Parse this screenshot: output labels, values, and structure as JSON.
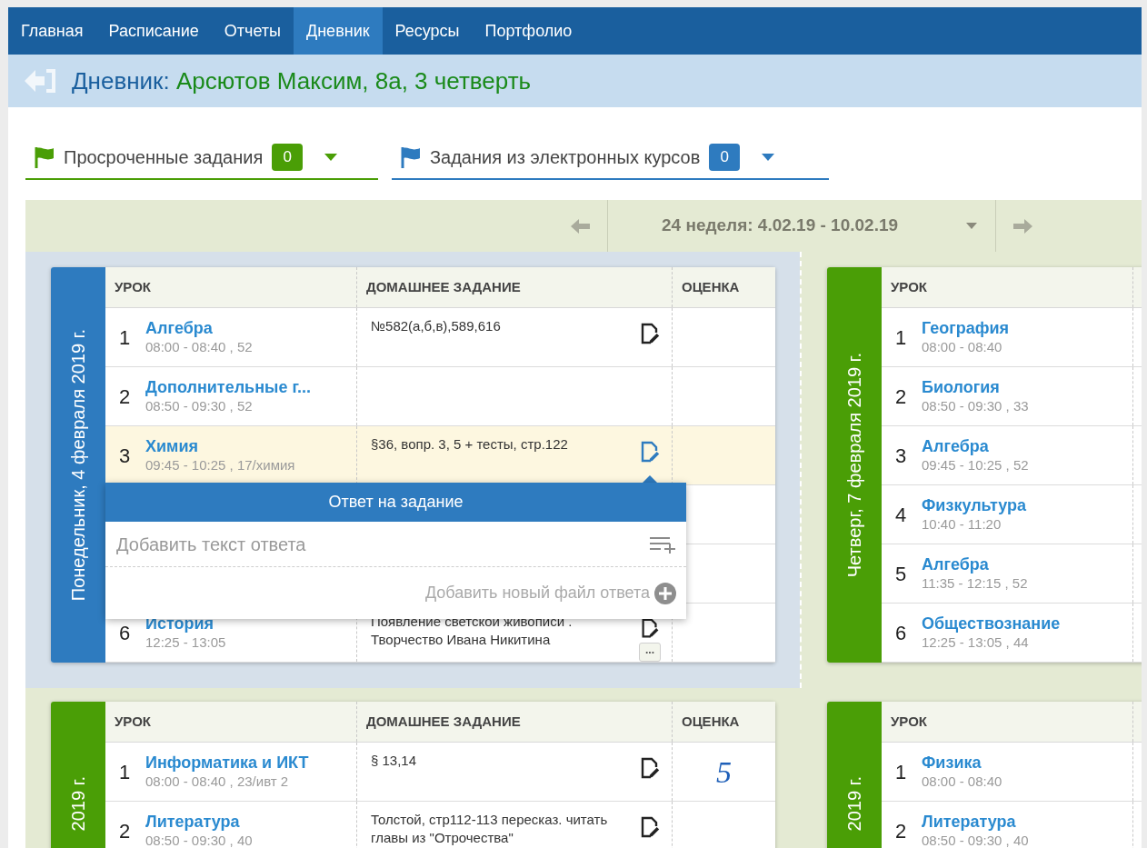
{
  "nav": [
    {
      "label": "Главная",
      "selected": false
    },
    {
      "label": "Расписание",
      "selected": false
    },
    {
      "label": "Отчеты",
      "selected": false
    },
    {
      "label": "Дневник",
      "selected": true
    },
    {
      "label": "Ресурсы",
      "selected": false
    },
    {
      "label": "Портфолио",
      "selected": false
    }
  ],
  "header": {
    "title": "Дневник:",
    "student": "Арсютов Максим, 8а, 3 четверть"
  },
  "filters": [
    {
      "label": "Просроченные задания",
      "count": "0",
      "color": "#4a9e06"
    },
    {
      "label": "Задания из электронных курсов",
      "count": "0",
      "color": "#2e7bbf"
    }
  ],
  "week": {
    "label": "24 неделя: 4.02.19 - 10.02.19"
  },
  "days": [
    {
      "date": "Понедельник, 4 февраля 2019 г.",
      "selected": true,
      "columns": [
        "УРОК",
        "ДОМАШНЕЕ ЗАДАНИЕ",
        "ОЦЕНКА"
      ],
      "lessons": [
        {
          "kind": "lesson",
          "number": "1",
          "subject": "Алгебра",
          "time": "08:00 - 08:40 , 52",
          "homework": "№582(а,б,в),589,616",
          "edit": true,
          "highlighted": false
        },
        {
          "kind": "lesson",
          "number": "2",
          "subject": "Дополнительные г...",
          "time": "08:50 - 09:30 , 52",
          "highlighted": false
        },
        {
          "kind": "lesson",
          "number": "3",
          "subject": "Химия",
          "time": "09:45 - 10:25 , 17/химия",
          "homework": "§36, вопр. 3, 5 + тесты, стр.122",
          "edit": true,
          "highlighted": true,
          "answer_popup": {
            "title": "Ответ на задание",
            "placeholder": "Добавить текст ответа",
            "add_file": "Добавить новый файл ответа"
          }
        },
        {
          "kind": "covered"
        },
        {
          "kind": "covered"
        },
        {
          "kind": "lesson",
          "number": "6",
          "subject": "История",
          "time": "12:25 - 13:05",
          "homework": "Появление светской живописи . Творчество Ивана Никитина",
          "edit": true,
          "highlighted": false,
          "more": "..."
        }
      ]
    },
    {
      "date": "Четверг, 7 февраля 2019 г.",
      "selected": false,
      "columns": [
        "УРОК"
      ],
      "lessons": [
        {
          "kind": "lesson",
          "number": "1",
          "subject": "География",
          "time": "08:00 - 08:40",
          "highlighted": false
        },
        {
          "kind": "lesson",
          "number": "2",
          "subject": "Биология",
          "time": "08:50 - 09:30 , 33",
          "highlighted": false
        },
        {
          "kind": "lesson",
          "number": "3",
          "subject": "Алгебра",
          "time": "09:45 - 10:25 , 52",
          "highlighted": false
        },
        {
          "kind": "lesson",
          "number": "4",
          "subject": "Физкультура",
          "time": "10:40 - 11:20",
          "highlighted": false
        },
        {
          "kind": "lesson",
          "number": "5",
          "subject": "Алгебра",
          "time": "11:35 - 12:15 , 52",
          "highlighted": false
        },
        {
          "kind": "lesson",
          "number": "6",
          "subject": "Обществознание",
          "time": "12:25 - 13:05 , 44",
          "highlighted": false
        }
      ]
    },
    {
      "date": "2019 г.",
      "selected": false,
      "columns": [
        "УРОК",
        "ДОМАШНЕЕ ЗАДАНИЕ",
        "ОЦЕНКА"
      ],
      "lessons": [
        {
          "kind": "lesson",
          "number": "1",
          "subject": "Информатика и ИКТ",
          "time": "08:00 - 08:40 , 23/ивт 2",
          "homework": "§ 13,14",
          "edit": true,
          "highlighted": false,
          "grade": "5"
        },
        {
          "kind": "lesson",
          "number": "2",
          "subject": "Литература",
          "time": "08:50 - 09:30 , 40",
          "homework": "Толстой, стр112-113 пересказ. читать главы из \"Отрочества\"",
          "edit": true,
          "highlighted": false
        }
      ]
    },
    {
      "date": "2019 г.",
      "selected": false,
      "columns": [
        "УРОК"
      ],
      "lessons": [
        {
          "kind": "lesson",
          "number": "1",
          "subject": "Физика",
          "time": "08:00 - 08:40",
          "highlighted": false
        },
        {
          "kind": "lesson",
          "number": "2",
          "subject": "Литература",
          "time": "08:50 - 09:30 , 40",
          "highlighted": false
        }
      ]
    }
  ]
}
